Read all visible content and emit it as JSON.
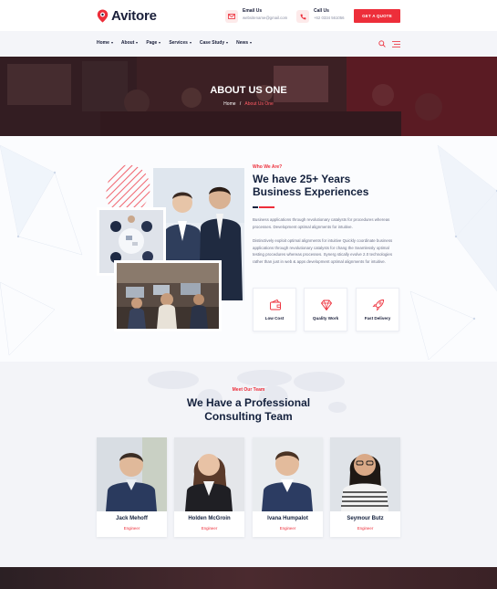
{
  "brand": {
    "name": "Avitore",
    "accent": "#ed2e3a",
    "navy": "#14213d"
  },
  "header": {
    "email": {
      "label": "Email Us",
      "value": "websitename@gmail.com"
    },
    "call": {
      "label": "Call Us",
      "value": "+62 0334 561056"
    },
    "quote_button": "GET A QUOTE"
  },
  "nav": {
    "items": [
      {
        "label": "Home"
      },
      {
        "label": "About"
      },
      {
        "label": "Page"
      },
      {
        "label": "Services"
      },
      {
        "label": "Case Study"
      },
      {
        "label": "News"
      }
    ],
    "icons": [
      "search-icon",
      "menu-icon"
    ]
  },
  "hero": {
    "title": "ABOUT US ONE",
    "breadcrumb": {
      "home": "Home",
      "separator": "/",
      "current": "About Us One"
    }
  },
  "about": {
    "tag": "Who We Are?",
    "title": "We have 25+ Years Business Experiences",
    "paragraph_1": "Business applications through revolutionary catalysts for procedures whereas processes. Development optimal alignments for intuitive.",
    "paragraph_2": "Distinctively exploit optimal alignments for intuitive Quickly coordinate business applications through revolutionary catalysts for chang the Seamlessly optimal testing procedures whereas processes. Synerg stically evolve 2.0 technologies rather than just in web & apps development optimal alignments for intuitive.",
    "features": [
      {
        "label": "Low Cost",
        "icon": "wallet-icon"
      },
      {
        "label": "Quality Work",
        "icon": "diamond-icon"
      },
      {
        "label": "Fast Delivery",
        "icon": "rocket-icon"
      }
    ]
  },
  "team": {
    "tag": "Meet Our Team",
    "title_line_1": "We Have a Professional",
    "title_line_2": "Consulting Team",
    "members": [
      {
        "name": "Jack Mehoff",
        "role": "Engineer"
      },
      {
        "name": "Holden McGroin",
        "role": "Engineer"
      },
      {
        "name": "Ivana Humpalot",
        "role": "Engineer"
      },
      {
        "name": "Seymour Butz",
        "role": "Engineer"
      }
    ]
  }
}
